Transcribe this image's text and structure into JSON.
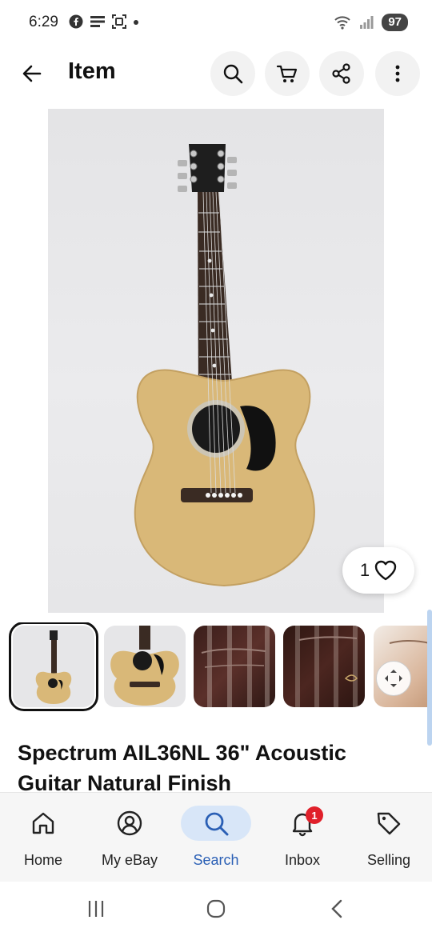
{
  "status_bar": {
    "time": "6:29",
    "battery": "97",
    "icons_left": [
      "facebook-icon",
      "news-icon",
      "screenshot-icon",
      "dot-icon"
    ],
    "icons_right": [
      "wifi-icon",
      "signal-icon",
      "battery-icon"
    ]
  },
  "app_bar": {
    "title": "Item",
    "actions": [
      "search-icon",
      "cart-icon",
      "share-icon",
      "more-icon"
    ]
  },
  "listing": {
    "title": "Spectrum AIL36NL 36\" Acoustic Guitar Natural Finish",
    "watch_count": "1",
    "thumbnail_count": 5,
    "selected_thumbnail": 1
  },
  "bottom_nav": {
    "items": [
      {
        "label": "Home",
        "icon": "home-icon"
      },
      {
        "label": "My eBay",
        "icon": "account-icon"
      },
      {
        "label": "Search",
        "icon": "search-icon",
        "active": true
      },
      {
        "label": "Inbox",
        "icon": "bell-icon",
        "badge": "1"
      },
      {
        "label": "Selling",
        "icon": "tag-icon"
      }
    ]
  },
  "colors": {
    "accent": "#2a5fb5",
    "active_pill": "#d8e6f8",
    "badge": "#e0202a",
    "guitar_body": "#d9b878"
  }
}
